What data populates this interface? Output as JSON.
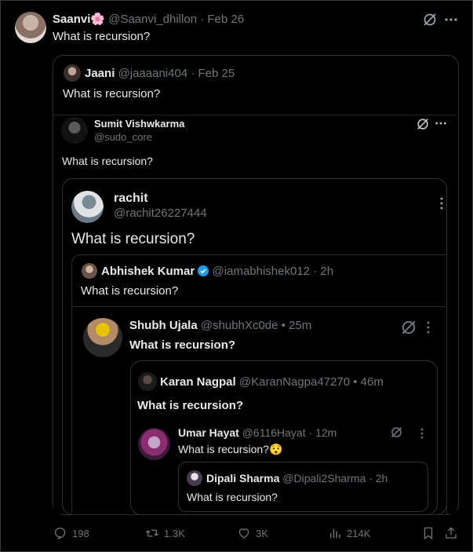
{
  "main": {
    "name": "Saanvi",
    "flower": "🌸",
    "handle": "@Saanvi_dhillon",
    "dot": "·",
    "date": "Feb 26",
    "text": "What is recursion?"
  },
  "q1": {
    "name": "Jaani",
    "handle": "@jaaaani404",
    "dot": "·",
    "date": "Feb 25",
    "text": "What is recursion?"
  },
  "q2": {
    "name": "Sumit Vishwkarma",
    "handle": "@sudo_core",
    "text": "What is recursion?"
  },
  "q3": {
    "name": "rachit",
    "handle": "@rachit26227444",
    "text": "What is recursion?"
  },
  "q4": {
    "name": "Abhishek Kumar",
    "handle": "@iamabhishek012",
    "dot": "·",
    "time": "2h",
    "text": "What is recursion?"
  },
  "q5": {
    "name": "Shubh Ujala",
    "handle": "@shubhXc0de",
    "dot": "•",
    "time": "25m",
    "text": "What is recursion?"
  },
  "q6": {
    "name": "Karan Nagpal",
    "handle": "@KaranNagpa47270",
    "dot": "•",
    "time": "46m",
    "text": "What is recursion?"
  },
  "q7": {
    "name": "Umar Hayat",
    "handle": "@6116Hayat",
    "dot": "·",
    "time": "12m",
    "text": "What is recursion?",
    "emoji": "😯"
  },
  "q8": {
    "name": "Dipali Sharma",
    "handle": "@Dipali2Sharma",
    "dot": "·",
    "time": "2h",
    "text": "What is recursion?"
  },
  "stats": {
    "replies": "198",
    "reposts": "1.3K",
    "likes": "3K",
    "views": "214K"
  },
  "icons": [
    "grok-icon",
    "more-icon",
    "reply-icon",
    "repost-icon",
    "like-icon",
    "views-icon",
    "bookmark-icon",
    "share-icon",
    "verified-badge-icon"
  ],
  "colors": {
    "background": "#000000",
    "text": "#e7e9ea",
    "muted": "#71767b",
    "border": "#2f3336",
    "verified": "#1d9bf0"
  }
}
